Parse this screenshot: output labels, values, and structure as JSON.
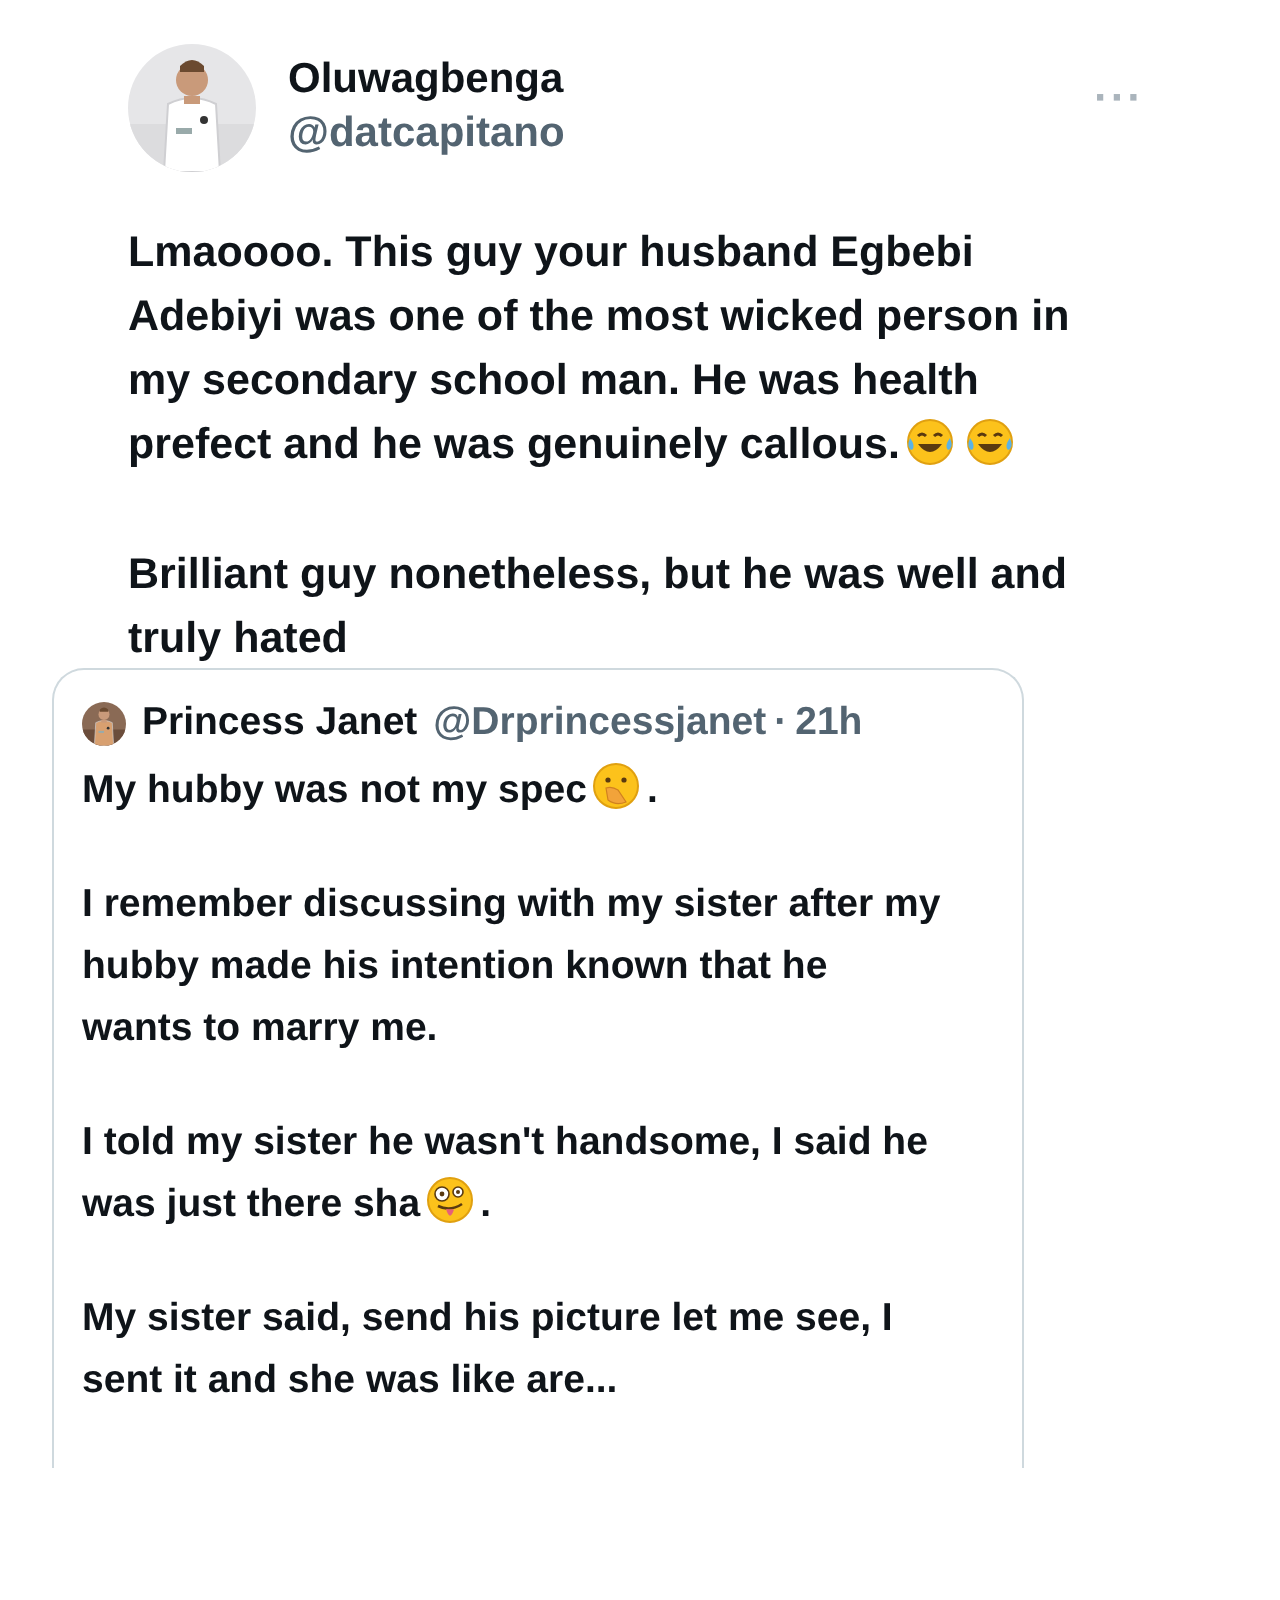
{
  "author": {
    "name": "Oluwagbenga",
    "handle": "@datcapitano",
    "avatar": {
      "kind": "picture"
    }
  },
  "more_button": {
    "label": "···"
  },
  "paragraphs": [
    [
      {
        "kind": "text",
        "text": "Lmaoooo. This guy your husband Egbebi Adebiyi was one of the most wicked person in my secondary school man. He was health prefect and he was genuinely callous."
      },
      {
        "kind": "tears_of_joy"
      },
      {
        "kind": "tears_of_joy"
      }
    ],
    [
      {
        "kind": "text",
        "text": "Brilliant guy nonetheless, but he was well and truly hated"
      }
    ]
  ],
  "quoted_tweet": {
    "name": "Princess Janet",
    "handle": "@Drprincessjanet",
    "separator": "·",
    "time": "21h",
    "avatar": {
      "kind": "picture"
    },
    "paragraphs": [
      [
        {
          "kind": "text",
          "text": "My hubby was not my spec"
        },
        {
          "kind": "hand_over_mouth"
        },
        {
          "kind": "text",
          "text": "."
        }
      ],
      [
        {
          "kind": "text",
          "text": "I remember discussing with my sister after my hubby made his intention known that he wants to marry me."
        }
      ],
      [
        {
          "kind": "text",
          "text": "I told my sister he wasn't handsome, I said he was just there sha"
        },
        {
          "kind": "zany"
        },
        {
          "kind": "text",
          "text": "."
        }
      ],
      [
        {
          "kind": "text",
          "text": "My sister said, send his picture let me see, I sent it and she was like are..."
        }
      ]
    ]
  }
}
